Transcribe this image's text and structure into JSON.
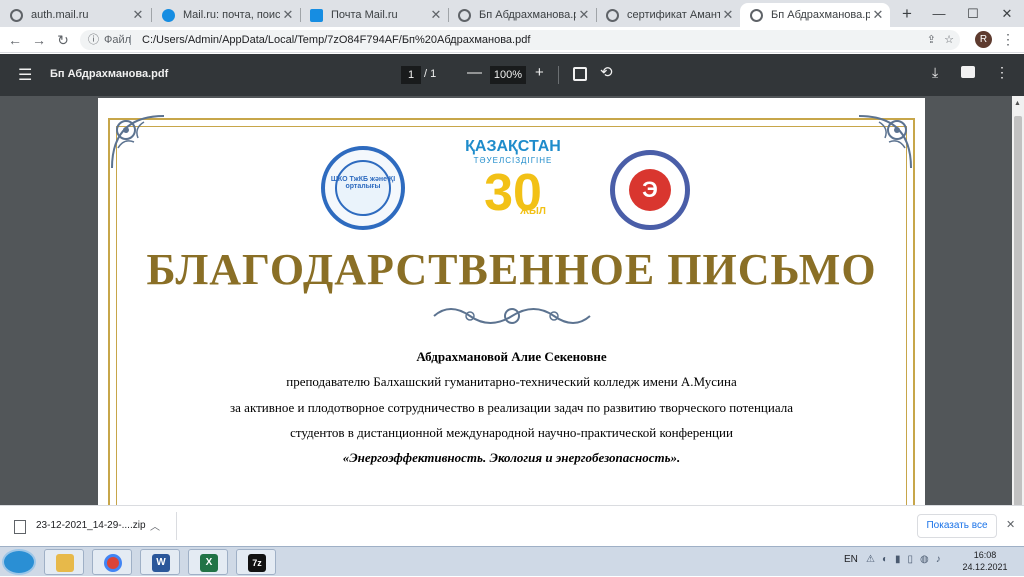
{
  "browser": {
    "tabs": [
      {
        "title": "auth.mail.ru",
        "icon": "globe-icon",
        "color": "#5f6368"
      },
      {
        "title": "Mail.ru: почта, поиск в и",
        "icon": "mailru-icon",
        "color": "#168de2"
      },
      {
        "title": "Почта Mail.ru",
        "icon": "mail-icon",
        "color": "#168de2"
      },
      {
        "title": "Бп Абдрахманова.pdf",
        "icon": "globe-icon",
        "color": "#5f6368"
      },
      {
        "title": "сертификат Амантаев.p",
        "icon": "globe-icon",
        "color": "#5f6368"
      },
      {
        "title": "Бп Абдрахманова.pdf",
        "icon": "globe-icon",
        "color": "#5f6368",
        "active": true
      }
    ],
    "address": {
      "label": "Файл",
      "url": "C:/Users/Admin/AppData/Local/Temp/7zO84F794AF/Бп%20Абдрахманова.pdf"
    },
    "profile_initial": "R"
  },
  "pdf_toolbar": {
    "filename": "Бп Абдрахманова.pdf",
    "page_current": "1",
    "page_total": "/  1",
    "zoom": "100%"
  },
  "document": {
    "logo_left_text": "ШКО ТжКБ және ҚІ орталығы",
    "kz_logo": {
      "word": "ҚАЗАҚСТАН",
      "sub": "ТӘУЕЛСІЗДІГІНЕ",
      "number": "30",
      "suffix": "ЖЫЛ"
    },
    "logo_right_text": "Э",
    "title": "БЛАГОДАРСТВЕННОЕ ПИСЬМО",
    "recipient": "Абдрахмановой Алие Секеновне",
    "line1": "преподавателю Балхашский гуманитарно-технический колледж имени А.Мусина",
    "line2": "за активное и плодотворное сотрудничество в реализации задач по развитию творческого потенциала",
    "line3": "студентов в дистанционной международной научно-практической конференции",
    "line4": "«Энергоэффективность. Экология и энергобезопасность».",
    "accent_color": "#c7a64a",
    "title_color": "#8a6f26"
  },
  "downloads": {
    "file": "23-12-2021_14-29-....zip",
    "show_all": "Показать все"
  },
  "taskbar": {
    "apps": [
      {
        "name": "explorer",
        "label": "",
        "color": "#e7b94a"
      },
      {
        "name": "chrome",
        "label": "",
        "color": "#db4437"
      },
      {
        "name": "word",
        "label": "W",
        "color": "#2b579a"
      },
      {
        "name": "excel",
        "label": "X",
        "color": "#217346"
      },
      {
        "name": "7zip",
        "label": "7z",
        "color": "#111111"
      }
    ],
    "lang": "EN",
    "time": "16:08",
    "date": "24.12.2021"
  }
}
